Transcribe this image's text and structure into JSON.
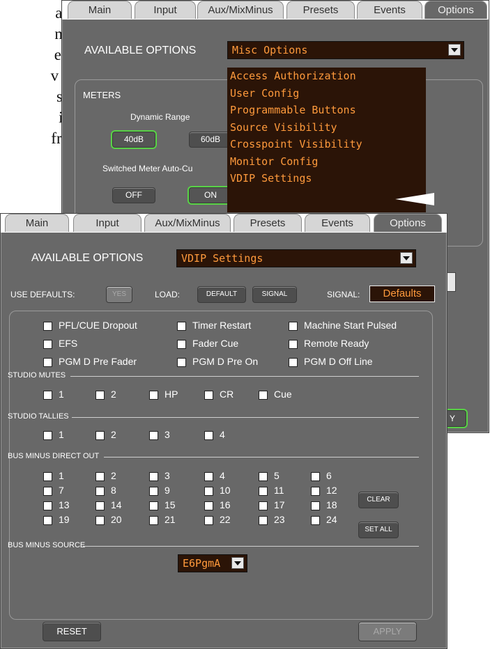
{
  "doc_text": [
    "ally,",
    "med",
    "e at-",
    "v the",
    "sole",
    "it is",
    "from"
  ],
  "back": {
    "tabs": [
      "Main",
      "Input",
      "Aux/MixMinus",
      "Presets",
      "Events",
      "Options"
    ],
    "available_label": "AVAILABLE OPTIONS",
    "dropdown_value": "Misc Options",
    "menu": [
      "Access Authorization",
      "User Config",
      "Programmable Buttons",
      "Source Visibility",
      "Crosspoint Visibility",
      "Monitor Config",
      "VDIP Settings"
    ],
    "meters_title": "METERS",
    "dynamic_range_label": "Dynamic Range",
    "btn_40db": "40dB",
    "btn_60db": "60dB",
    "switched_label": "Switched Meter Auto-Cu",
    "btn_off": "OFF",
    "btn_on": "ON",
    "apply_partial": "Y"
  },
  "front": {
    "tabs": [
      "Main",
      "Input",
      "Aux/MixMinus",
      "Presets",
      "Events",
      "Options"
    ],
    "available_label": "AVAILABLE OPTIONS",
    "dropdown_value": "VDIP Settings",
    "use_defaults_label": "USE DEFAULTS:",
    "yes_btn": "YES",
    "load_label": "LOAD:",
    "default_btn": "DEFAULT",
    "signal_btn": "SIGNAL",
    "signal_label": "SIGNAL:",
    "signal_value": "Defaults",
    "options": [
      "PFL/CUE Dropout",
      "Timer Restart",
      "Machine Start Pulsed",
      "EFS",
      "Fader Cue",
      "Remote Ready",
      "PGM D Pre Fader",
      "PGM D Pre On",
      "PGM D Off Line"
    ],
    "studio_mutes_label": "STUDIO MUTES",
    "studio_mutes": [
      "1",
      "2",
      "HP",
      "CR",
      "Cue"
    ],
    "studio_tallies_label": "STUDIO TALLIES",
    "studio_tallies": [
      "1",
      "2",
      "3",
      "4"
    ],
    "bus_minus_label": "BUS MINUS DIRECT OUT",
    "bus_minus": [
      "1",
      "2",
      "3",
      "4",
      "5",
      "6",
      "7",
      "8",
      "9",
      "10",
      "11",
      "12",
      "13",
      "14",
      "15",
      "16",
      "17",
      "18",
      "19",
      "20",
      "21",
      "22",
      "23",
      "24"
    ],
    "clear_btn": "CLEAR",
    "set_all_btn": "SET ALL",
    "bus_source_label": "BUS MINUS SOURCE",
    "bus_source_value": "E6PgmA",
    "reset_btn": "RESET",
    "apply_btn": "APPLY"
  }
}
